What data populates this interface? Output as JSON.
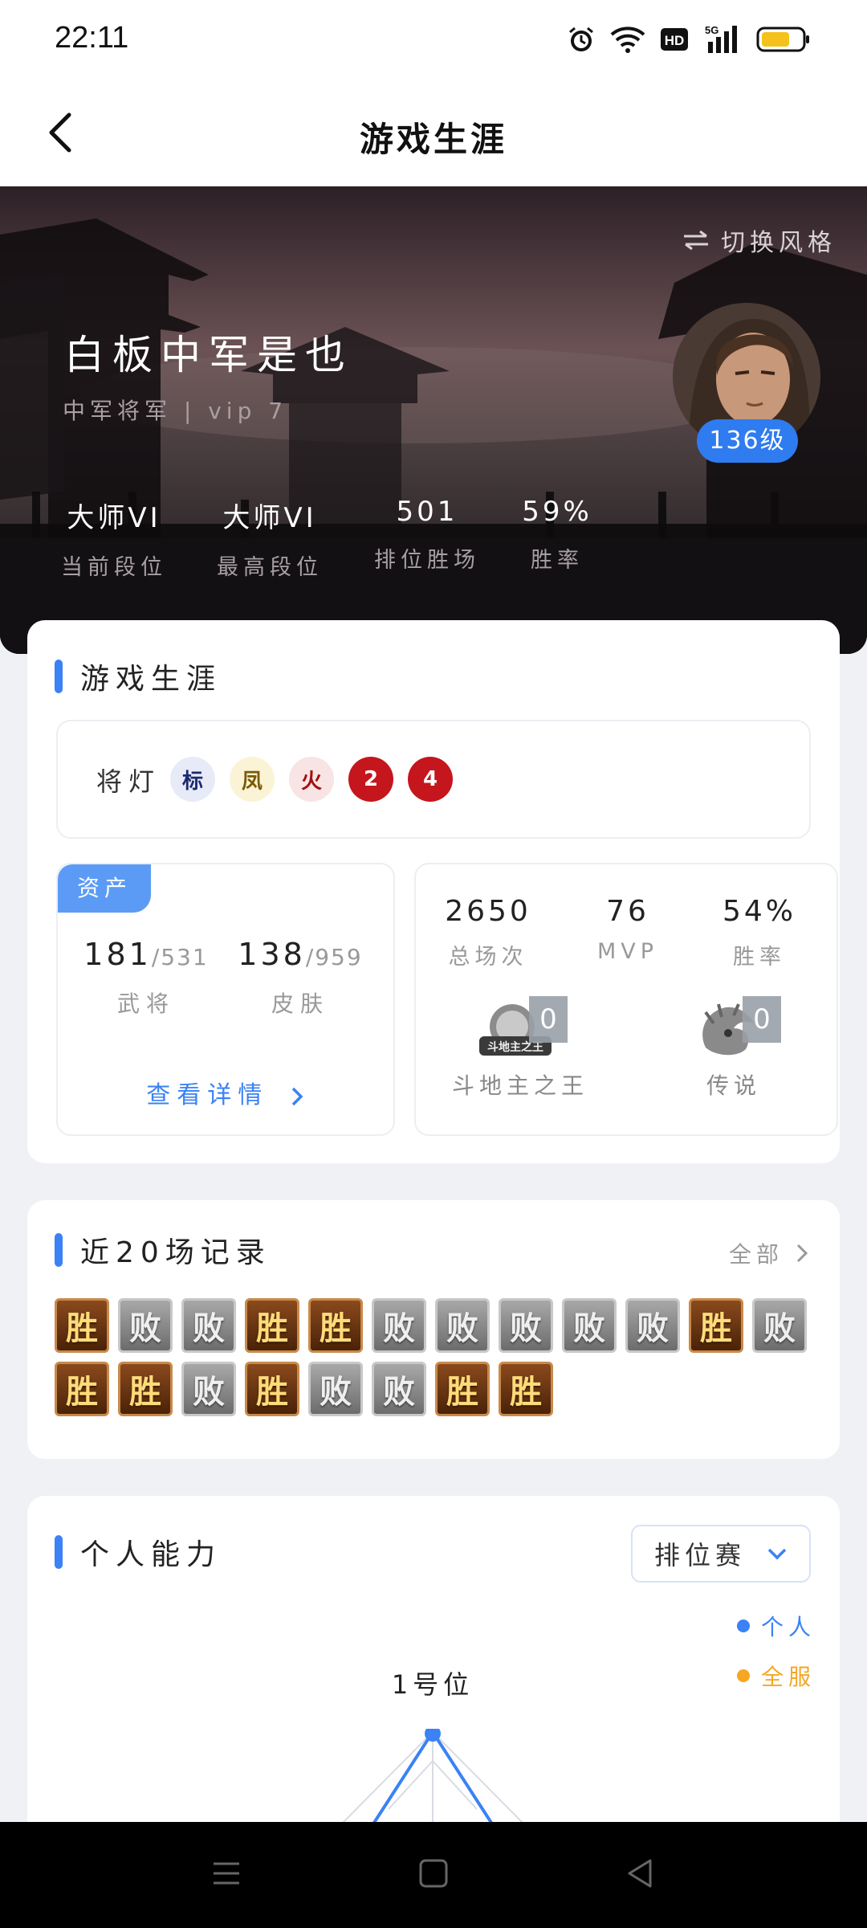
{
  "status_bar": {
    "time": "22:11",
    "icons": [
      "alarm-icon",
      "wifi-icon",
      "hd-icon",
      "5g-signal-icon",
      "battery-icon"
    ]
  },
  "header": {
    "title": "游戏生涯",
    "back_icon": "chevron-left-icon"
  },
  "hero": {
    "switch_label": "切换风格",
    "nickname": "白板中军是也",
    "subtitle": "中军将军 | vip 7",
    "level": "136级",
    "stats": [
      {
        "value": "大师VI",
        "label": "当前段位"
      },
      {
        "value": "大师VI",
        "label": "最高段位"
      },
      {
        "value": "501",
        "label": "排位胜场"
      },
      {
        "value": "59%",
        "label": "胜率"
      }
    ]
  },
  "career": {
    "title": "游戏生涯",
    "lamps_label": "将灯",
    "lamps": [
      {
        "char": "标",
        "color": "#1c2a6e",
        "bg": "#e7ebf8"
      },
      {
        "char": "凤",
        "color": "#7a5a00",
        "bg": "#faf3d6"
      },
      {
        "char": "火",
        "color": "#a31010",
        "bg": "#f8e4e4"
      },
      {
        "char": "2",
        "color": "#ffffff",
        "bg": "#c4161c"
      },
      {
        "char": "4",
        "color": "#ffffff",
        "bg": "#c4161c"
      }
    ],
    "assets": {
      "tag": "资产",
      "generals": {
        "owned": "181",
        "total": "/531",
        "label": "武将"
      },
      "skins": {
        "owned": "138",
        "total": "/959",
        "label": "皮肤"
      },
      "detail_label": "查看详情"
    },
    "totals": [
      {
        "value": "2650",
        "label": "总场次"
      },
      {
        "value": "76",
        "label": "MVP"
      },
      {
        "value": "54%",
        "label": "胜率"
      }
    ],
    "badges": [
      {
        "label": "斗地主之王",
        "count": "0",
        "art_text": "斗地主之王"
      },
      {
        "label": "传说",
        "count": "0"
      }
    ]
  },
  "records": {
    "title": "近20场记录",
    "all_label": "全部",
    "results": [
      "胜",
      "败",
      "败",
      "胜",
      "胜",
      "败",
      "败",
      "败",
      "败",
      "败",
      "胜",
      "败",
      "胜",
      "胜",
      "败",
      "胜",
      "败",
      "败",
      "胜",
      "胜"
    ]
  },
  "ability": {
    "title": "个人能力",
    "mode": "排位赛",
    "legend": [
      {
        "label": "个人",
        "color": "#3a82f6"
      },
      {
        "label": "全服",
        "color": "#f5a623"
      }
    ],
    "position_label": "1号位"
  }
}
